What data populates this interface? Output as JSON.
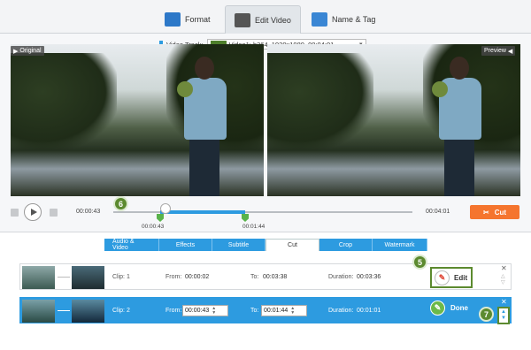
{
  "top_tabs": [
    {
      "label": "Format",
      "icon": "format-icon"
    },
    {
      "label": "Edit Video",
      "icon": "edit-video-icon"
    },
    {
      "label": "Name & Tag",
      "icon": "name-tag-icon"
    }
  ],
  "preview": {
    "original_label": "Original",
    "preview_label": "Preview",
    "video_track_label": "Video Track:",
    "video_track_value": "Video1: h264, 1920x1080, 00:04:01"
  },
  "player": {
    "current_time": "00:00:43",
    "total_time": "00:04:01",
    "marker_start": "00:00:43",
    "marker_end": "00:01:44",
    "cut_label": "Cut",
    "selection_start_fraction": 0.179,
    "selection_end_fraction": 0.432
  },
  "callouts": {
    "five": "5",
    "six": "6",
    "seven": "7"
  },
  "edit_tabs": [
    {
      "label": "Audio & Video",
      "active": false
    },
    {
      "label": "Effects",
      "active": false
    },
    {
      "label": "Subtitle",
      "active": false
    },
    {
      "label": "Cut",
      "active": true
    },
    {
      "label": "Crop",
      "active": false
    },
    {
      "label": "Watermark",
      "active": false
    }
  ],
  "clips": [
    {
      "clip_label": "Clip: 1",
      "from_label": "From:",
      "from": "00:00:02",
      "to_label": "To:",
      "to": "00:03:38",
      "duration_label": "Duration:",
      "duration": "00:03:36",
      "action": "Edit"
    },
    {
      "clip_label": "Clip: 2",
      "from_label": "From:",
      "from": "00:00:43",
      "to_label": "To:",
      "to": "00:01:44",
      "duration_label": "Duration:",
      "duration": "00:01:01",
      "action": "Done"
    }
  ],
  "colors": {
    "accent": "#2d9be0",
    "cut": "#f5752e",
    "callout": "#5c8a2f"
  }
}
